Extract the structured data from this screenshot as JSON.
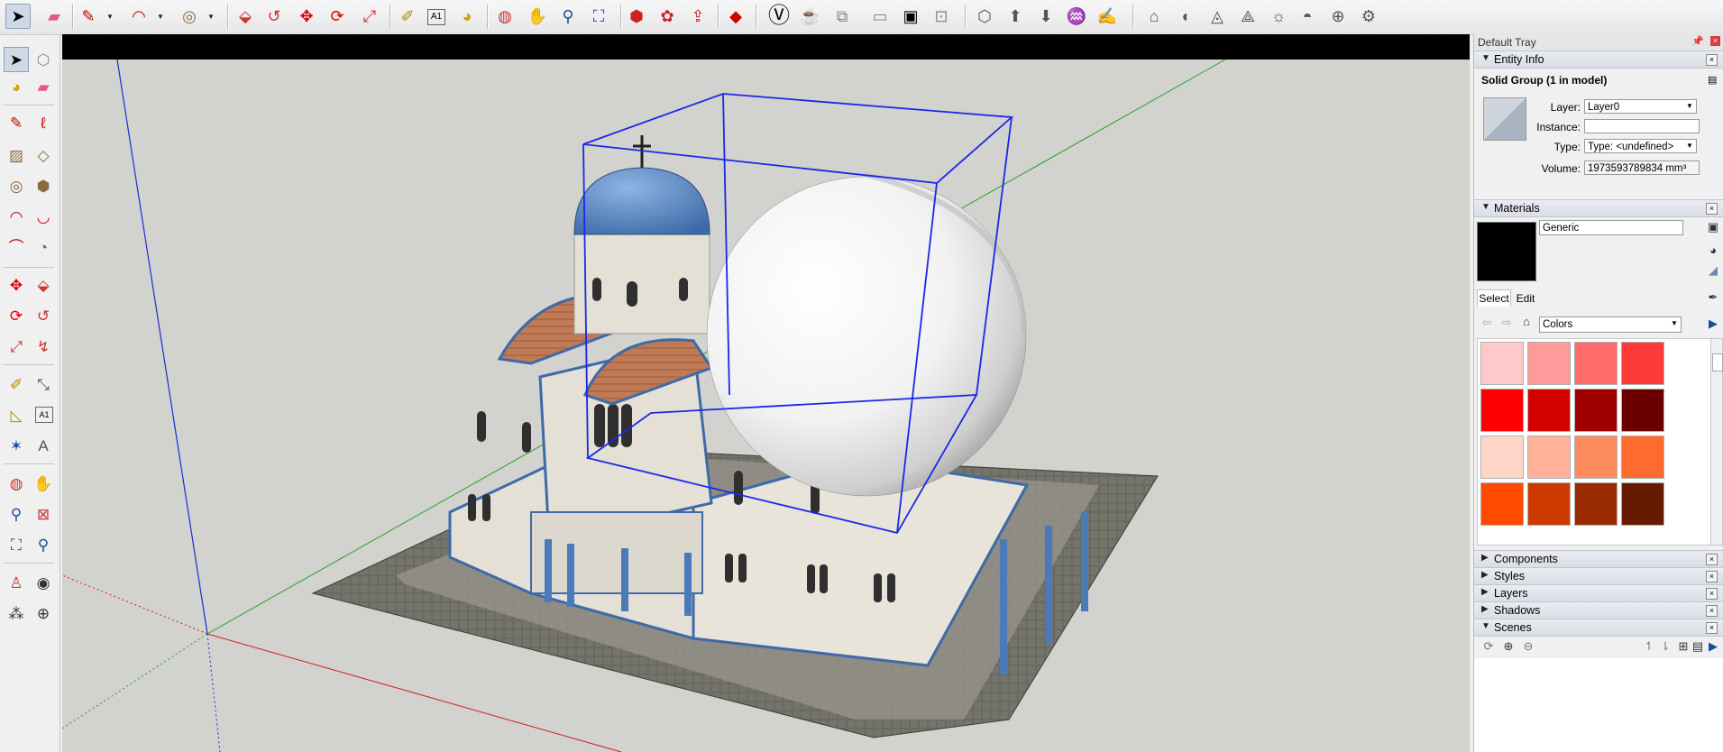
{
  "toolbar": {
    "icons": [
      "select-icon",
      "eraser-icon",
      "pencil-icon",
      "arc-icon",
      "circle-icon",
      "push-pull-icon",
      "follow-me-icon",
      "move-icon",
      "rotate-icon",
      "scale-icon",
      "tape-measure-icon",
      "text-icon",
      "paint-bucket-icon",
      "orbit-icon",
      "pan-icon",
      "zoom-icon",
      "zoom-extents-icon",
      "warehouse-icon",
      "extension-warehouse-icon",
      "share-model-icon",
      "ruby-icon",
      "solid-tools-icons",
      "styles-icons",
      "views-icons",
      "sandbox-icons"
    ]
  },
  "tray": {
    "title": "Default Tray",
    "entity_info": {
      "header": "Entity Info",
      "selection": "Solid Group (1 in model)",
      "layer_label": "Layer:",
      "layer_value": "Layer0",
      "instance_label": "Instance:",
      "instance_value": "",
      "type_label": "Type:",
      "type_value": "Type: <undefined>",
      "volume_label": "Volume:",
      "volume_value": "1973593789834 mm³"
    },
    "materials": {
      "header": "Materials",
      "name_value": "Generic",
      "tab_select": "Select",
      "tab_edit": "Edit",
      "library": "Colors",
      "swatches": [
        "#ffc9c9",
        "#ff9a9a",
        "#ff6b6b",
        "#ff3a3a",
        "#ff0000",
        "#d40000",
        "#a00000",
        "#6b0000",
        "#ffd5c8",
        "#ffb199",
        "#ff8c5f",
        "#ff6a2e",
        "#ff4a00",
        "#cc3a00",
        "#992a00",
        "#661a00"
      ]
    },
    "collapsed": [
      "Components",
      "Styles",
      "Layers",
      "Shadows"
    ],
    "scenes": {
      "header": "Scenes"
    }
  }
}
